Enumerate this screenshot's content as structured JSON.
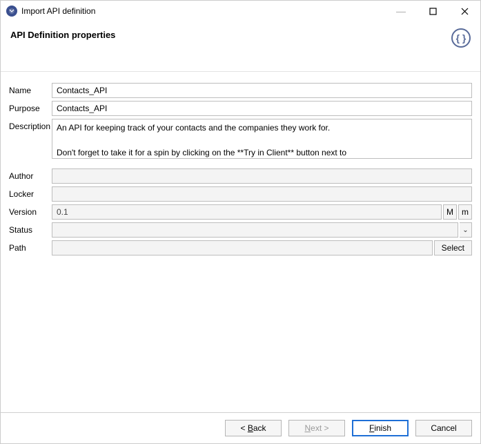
{
  "window": {
    "title": "Import API definition"
  },
  "header": {
    "title": "API Definition properties"
  },
  "labels": {
    "name": "Name",
    "purpose": "Purpose",
    "description": "Description",
    "author": "Author",
    "locker": "Locker",
    "version": "Version",
    "status": "Status",
    "path": "Path"
  },
  "form": {
    "name": "Contacts_API",
    "purpose": "Contacts_API",
    "description_line1": "An API for keeping track of your contacts and the companies they work for.",
    "description_line2": "Don't forget to take it for a spin by clicking on the **Try in Client** button next to",
    "author": "",
    "locker": "",
    "version": "0.1",
    "status": "",
    "path": ""
  },
  "buttons": {
    "version_major": "M",
    "version_minor": "m",
    "select": "Select",
    "back_prefix": "< ",
    "back_mn": "B",
    "back_suffix": "ack",
    "next_mn": "N",
    "next_suffix": "ext >",
    "finish_mn": "F",
    "finish_suffix": "inish",
    "cancel": "Cancel"
  }
}
